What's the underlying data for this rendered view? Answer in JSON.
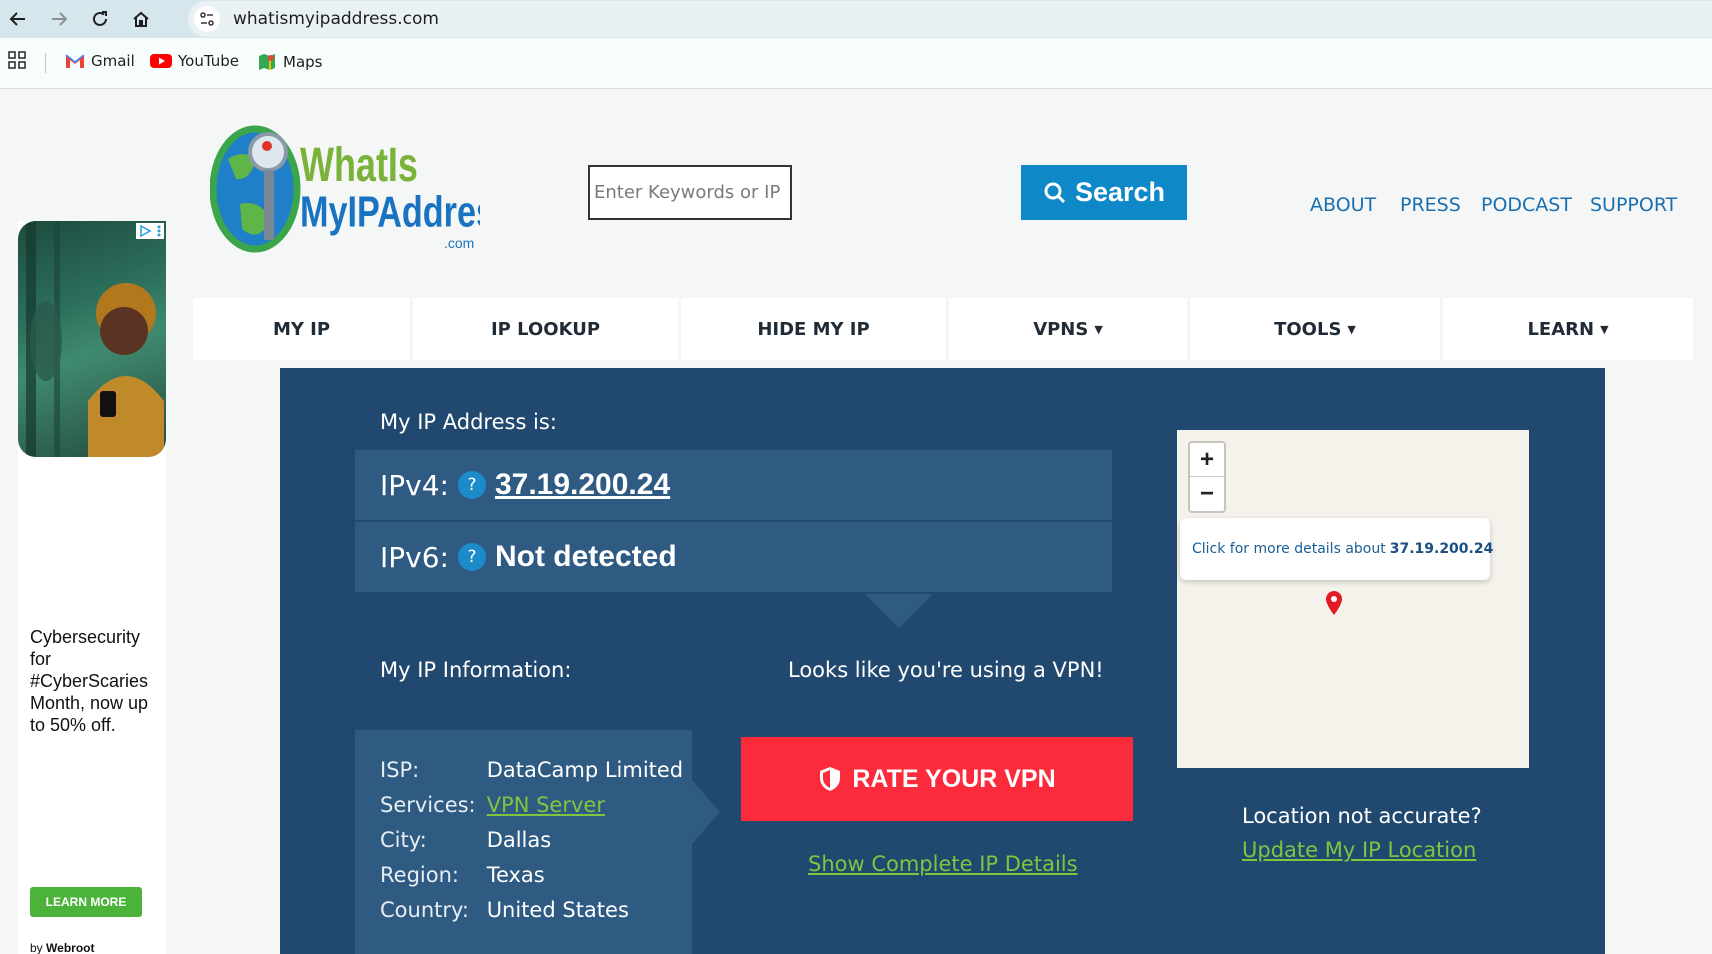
{
  "browser": {
    "url": "whatismyipaddress.com",
    "bookmarks": [
      "Gmail",
      "YouTube",
      "Maps"
    ]
  },
  "ad": {
    "text": "Cybersecurity for #CyberScaries Month, now up to 50% off.",
    "button": "LEARN MORE",
    "by_prefix": "by",
    "by_brand": "Webroot"
  },
  "header": {
    "logo_line1": "WhatIs",
    "logo_line2": "MyIPAddress",
    "logo_line3": ".com",
    "search_placeholder": "Enter Keywords or IP Address",
    "search_button": "Search",
    "links": [
      "ABOUT",
      "PRESS",
      "PODCAST",
      "SUPPORT"
    ]
  },
  "nav": [
    {
      "label": "MY IP",
      "caret": ""
    },
    {
      "label": "IP LOOKUP",
      "caret": ""
    },
    {
      "label": "HIDE MY IP",
      "caret": ""
    },
    {
      "label": "VPNS",
      "caret": "▼"
    },
    {
      "label": "TOOLS",
      "caret": "▼"
    },
    {
      "label": "LEARN",
      "caret": "▼"
    }
  ],
  "ip": {
    "heading": "My IP Address is:",
    "ipv4_label": "IPv4:",
    "ipv4_value": "37.19.200.24",
    "ipv6_label": "IPv6:",
    "ipv6_value": "Not detected",
    "help": "?"
  },
  "info": {
    "heading": "My IP Information:",
    "rows": [
      {
        "key": "ISP:",
        "value": "DataCamp Limited"
      },
      {
        "key": "Services:",
        "value": "VPN Server"
      },
      {
        "key": "City:",
        "value": "Dallas"
      },
      {
        "key": "Region:",
        "value": "Texas"
      },
      {
        "key": "Country:",
        "value": "United States"
      }
    ]
  },
  "vpn": {
    "note": "Looks like you're using a VPN!",
    "rate_button": "RATE YOUR VPN",
    "details_link": "Show Complete IP Details"
  },
  "map": {
    "zoom_in": "+",
    "zoom_out": "−",
    "popup_text": "Click for more details about",
    "popup_ip": "37.19.200.24"
  },
  "location": {
    "question": "Location not accurate?",
    "update_link": "Update My IP Location"
  },
  "colors": {
    "panel": "#21496f",
    "panel_box": "#2f5b82",
    "accent_blue": "#0f88c8",
    "link_green": "#7fc53f",
    "rate_red": "#fc2b3b"
  }
}
